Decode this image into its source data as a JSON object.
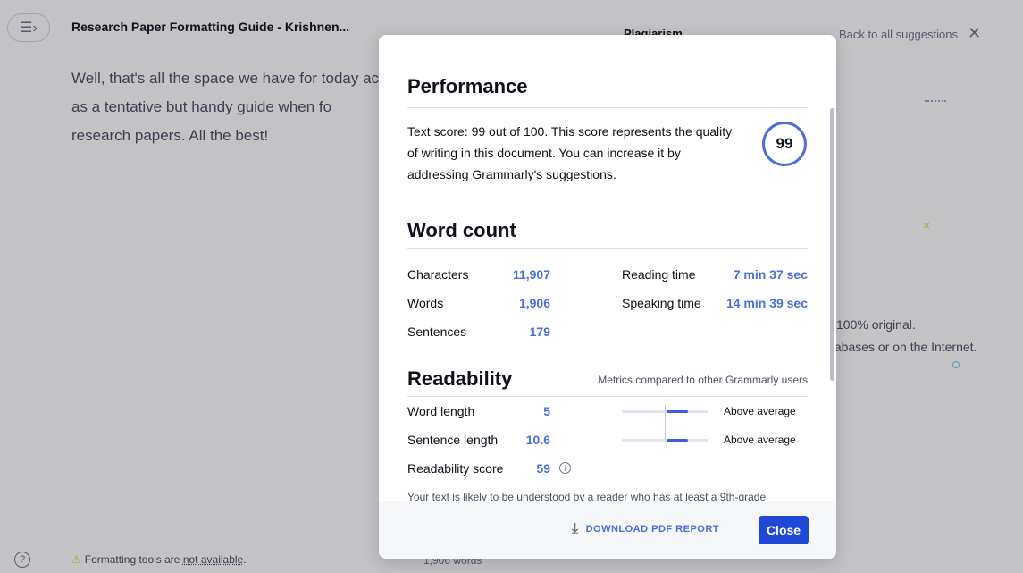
{
  "document": {
    "title": "Research Paper Formatting Guide - Krishnen...",
    "text": "Well, that's all the space we have for today acts as a tentative but handy guide when fo research papers. All the best!",
    "warning": "Formatting tools are",
    "warning_link": "not available",
    "warning_end": ".",
    "word_count": "1,906 words"
  },
  "right_panel": {
    "heading": "Plagiarism",
    "back_label": "Back to all suggestions",
    "line1": "100% original.",
    "line2": "tabases or on the Internet."
  },
  "modal": {
    "performance": {
      "title": "Performance",
      "text": "Text score: 99 out of 100. This score represents the quality of writing in this document. You can increase it by addressing Grammarly's suggestions.",
      "score": "99"
    },
    "word_count": {
      "title": "Word count",
      "characters_label": "Characters",
      "characters": "11,907",
      "words_label": "Words",
      "words": "1,906",
      "sentences_label": "Sentences",
      "sentences": "179",
      "reading_label": "Reading time",
      "reading": "7 min 37 sec",
      "speaking_label": "Speaking time",
      "speaking": "14 min 39 sec"
    },
    "readability": {
      "title": "Readability",
      "note": "Metrics compared to other Grammarly users",
      "word_length_label": "Word length",
      "word_length": "5",
      "word_length_rating": "Above average",
      "word_length_level": 0.58,
      "sentence_length_label": "Sentence length",
      "sentence_length": "10.6",
      "sentence_length_rating": "Above average",
      "sentence_length_level": 0.58,
      "score_label": "Readability score",
      "score": "59",
      "footnote": "Your text is likely to be understood by a reader who has at least a 9th-grade"
    },
    "download_label": "DOWNLOAD PDF REPORT",
    "close_label": "Close"
  },
  "icons": {
    "menu": "hamburger-icon",
    "help": "help-icon",
    "warning": "warning-icon",
    "close": "close-icon",
    "info": "info-icon",
    "download": "download-icon"
  }
}
